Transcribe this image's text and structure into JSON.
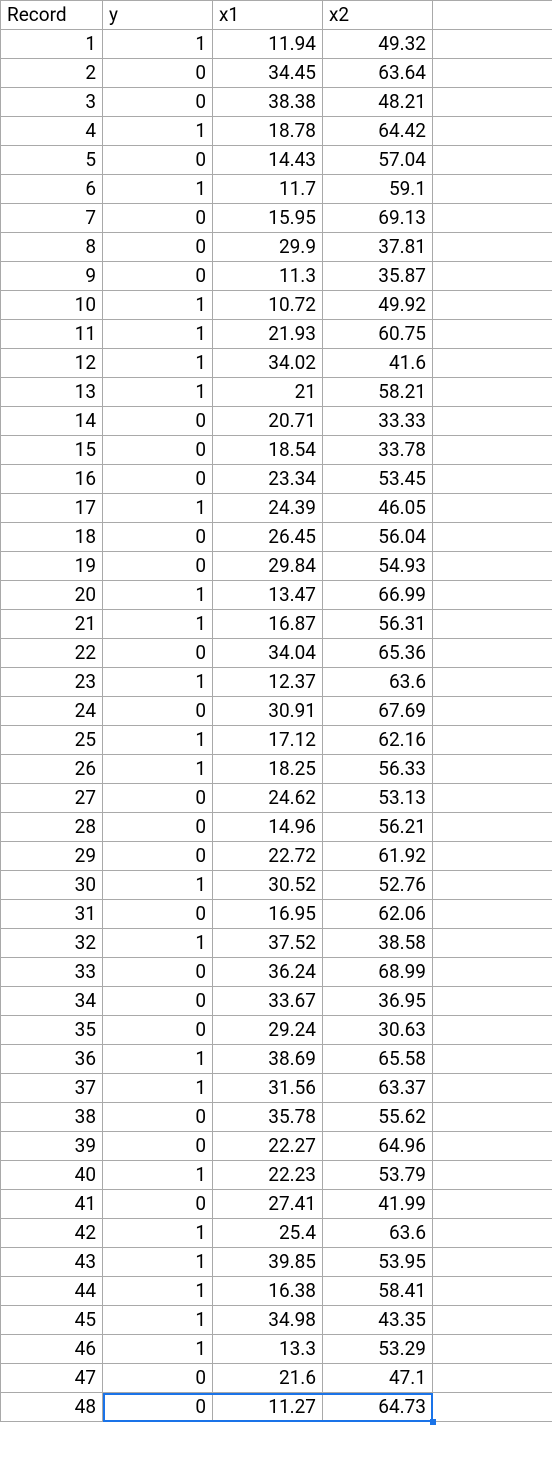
{
  "table": {
    "headers": [
      "Record",
      "y",
      "x1",
      "x2",
      ""
    ],
    "rows": [
      {
        "record": "1",
        "y": "1",
        "x1": "11.94",
        "x2": "49.32"
      },
      {
        "record": "2",
        "y": "0",
        "x1": "34.45",
        "x2": "63.64"
      },
      {
        "record": "3",
        "y": "0",
        "x1": "38.38",
        "x2": "48.21"
      },
      {
        "record": "4",
        "y": "1",
        "x1": "18.78",
        "x2": "64.42"
      },
      {
        "record": "5",
        "y": "0",
        "x1": "14.43",
        "x2": "57.04"
      },
      {
        "record": "6",
        "y": "1",
        "x1": "11.7",
        "x2": "59.1"
      },
      {
        "record": "7",
        "y": "0",
        "x1": "15.95",
        "x2": "69.13"
      },
      {
        "record": "8",
        "y": "0",
        "x1": "29.9",
        "x2": "37.81"
      },
      {
        "record": "9",
        "y": "0",
        "x1": "11.3",
        "x2": "35.87"
      },
      {
        "record": "10",
        "y": "1",
        "x1": "10.72",
        "x2": "49.92"
      },
      {
        "record": "11",
        "y": "1",
        "x1": "21.93",
        "x2": "60.75"
      },
      {
        "record": "12",
        "y": "1",
        "x1": "34.02",
        "x2": "41.6"
      },
      {
        "record": "13",
        "y": "1",
        "x1": "21",
        "x2": "58.21"
      },
      {
        "record": "14",
        "y": "0",
        "x1": "20.71",
        "x2": "33.33"
      },
      {
        "record": "15",
        "y": "0",
        "x1": "18.54",
        "x2": "33.78"
      },
      {
        "record": "16",
        "y": "0",
        "x1": "23.34",
        "x2": "53.45"
      },
      {
        "record": "17",
        "y": "1",
        "x1": "24.39",
        "x2": "46.05"
      },
      {
        "record": "18",
        "y": "0",
        "x1": "26.45",
        "x2": "56.04"
      },
      {
        "record": "19",
        "y": "0",
        "x1": "29.84",
        "x2": "54.93"
      },
      {
        "record": "20",
        "y": "1",
        "x1": "13.47",
        "x2": "66.99"
      },
      {
        "record": "21",
        "y": "1",
        "x1": "16.87",
        "x2": "56.31"
      },
      {
        "record": "22",
        "y": "0",
        "x1": "34.04",
        "x2": "65.36"
      },
      {
        "record": "23",
        "y": "1",
        "x1": "12.37",
        "x2": "63.6"
      },
      {
        "record": "24",
        "y": "0",
        "x1": "30.91",
        "x2": "67.69"
      },
      {
        "record": "25",
        "y": "1",
        "x1": "17.12",
        "x2": "62.16"
      },
      {
        "record": "26",
        "y": "1",
        "x1": "18.25",
        "x2": "56.33"
      },
      {
        "record": "27",
        "y": "0",
        "x1": "24.62",
        "x2": "53.13"
      },
      {
        "record": "28",
        "y": "0",
        "x1": "14.96",
        "x2": "56.21"
      },
      {
        "record": "29",
        "y": "0",
        "x1": "22.72",
        "x2": "61.92"
      },
      {
        "record": "30",
        "y": "1",
        "x1": "30.52",
        "x2": "52.76"
      },
      {
        "record": "31",
        "y": "0",
        "x1": "16.95",
        "x2": "62.06"
      },
      {
        "record": "32",
        "y": "1",
        "x1": "37.52",
        "x2": "38.58"
      },
      {
        "record": "33",
        "y": "0",
        "x1": "36.24",
        "x2": "68.99"
      },
      {
        "record": "34",
        "y": "0",
        "x1": "33.67",
        "x2": "36.95"
      },
      {
        "record": "35",
        "y": "0",
        "x1": "29.24",
        "x2": "30.63"
      },
      {
        "record": "36",
        "y": "1",
        "x1": "38.69",
        "x2": "65.58"
      },
      {
        "record": "37",
        "y": "1",
        "x1": "31.56",
        "x2": "63.37"
      },
      {
        "record": "38",
        "y": "0",
        "x1": "35.78",
        "x2": "55.62"
      },
      {
        "record": "39",
        "y": "0",
        "x1": "22.27",
        "x2": "64.96"
      },
      {
        "record": "40",
        "y": "1",
        "x1": "22.23",
        "x2": "53.79"
      },
      {
        "record": "41",
        "y": "0",
        "x1": "27.41",
        "x2": "41.99"
      },
      {
        "record": "42",
        "y": "1",
        "x1": "25.4",
        "x2": "63.6"
      },
      {
        "record": "43",
        "y": "1",
        "x1": "39.85",
        "x2": "53.95"
      },
      {
        "record": "44",
        "y": "1",
        "x1": "16.38",
        "x2": "58.41"
      },
      {
        "record": "45",
        "y": "1",
        "x1": "34.98",
        "x2": "43.35"
      },
      {
        "record": "46",
        "y": "1",
        "x1": "13.3",
        "x2": "53.29"
      },
      {
        "record": "47",
        "y": "0",
        "x1": "21.6",
        "x2": "47.1"
      },
      {
        "record": "48",
        "y": "0",
        "x1": "11.27",
        "x2": "64.73"
      }
    ],
    "selected_row_index": 47
  },
  "chart_data": {
    "type": "table",
    "columns": [
      "Record",
      "y",
      "x1",
      "x2"
    ],
    "rows": [
      [
        1,
        1,
        11.94,
        49.32
      ],
      [
        2,
        0,
        34.45,
        63.64
      ],
      [
        3,
        0,
        38.38,
        48.21
      ],
      [
        4,
        1,
        18.78,
        64.42
      ],
      [
        5,
        0,
        14.43,
        57.04
      ],
      [
        6,
        1,
        11.7,
        59.1
      ],
      [
        7,
        0,
        15.95,
        69.13
      ],
      [
        8,
        0,
        29.9,
        37.81
      ],
      [
        9,
        0,
        11.3,
        35.87
      ],
      [
        10,
        1,
        10.72,
        49.92
      ],
      [
        11,
        1,
        21.93,
        60.75
      ],
      [
        12,
        1,
        34.02,
        41.6
      ],
      [
        13,
        1,
        21,
        58.21
      ],
      [
        14,
        0,
        20.71,
        33.33
      ],
      [
        15,
        0,
        18.54,
        33.78
      ],
      [
        16,
        0,
        23.34,
        53.45
      ],
      [
        17,
        1,
        24.39,
        46.05
      ],
      [
        18,
        0,
        26.45,
        56.04
      ],
      [
        19,
        0,
        29.84,
        54.93
      ],
      [
        20,
        1,
        13.47,
        66.99
      ],
      [
        21,
        1,
        16.87,
        56.31
      ],
      [
        22,
        0,
        34.04,
        65.36
      ],
      [
        23,
        1,
        12.37,
        63.6
      ],
      [
        24,
        0,
        30.91,
        67.69
      ],
      [
        25,
        1,
        17.12,
        62.16
      ],
      [
        26,
        1,
        18.25,
        56.33
      ],
      [
        27,
        0,
        24.62,
        53.13
      ],
      [
        28,
        0,
        14.96,
        56.21
      ],
      [
        29,
        0,
        22.72,
        61.92
      ],
      [
        30,
        1,
        30.52,
        52.76
      ],
      [
        31,
        0,
        16.95,
        62.06
      ],
      [
        32,
        1,
        37.52,
        38.58
      ],
      [
        33,
        0,
        36.24,
        68.99
      ],
      [
        34,
        0,
        33.67,
        36.95
      ],
      [
        35,
        0,
        29.24,
        30.63
      ],
      [
        36,
        1,
        38.69,
        65.58
      ],
      [
        37,
        1,
        31.56,
        63.37
      ],
      [
        38,
        0,
        35.78,
        55.62
      ],
      [
        39,
        0,
        22.27,
        64.96
      ],
      [
        40,
        1,
        22.23,
        53.79
      ],
      [
        41,
        0,
        27.41,
        41.99
      ],
      [
        42,
        1,
        25.4,
        63.6
      ],
      [
        43,
        1,
        39.85,
        53.95
      ],
      [
        44,
        1,
        16.38,
        58.41
      ],
      [
        45,
        1,
        34.98,
        43.35
      ],
      [
        46,
        1,
        13.3,
        53.29
      ],
      [
        47,
        0,
        21.6,
        47.1
      ],
      [
        48,
        0,
        11.27,
        64.73
      ]
    ]
  }
}
